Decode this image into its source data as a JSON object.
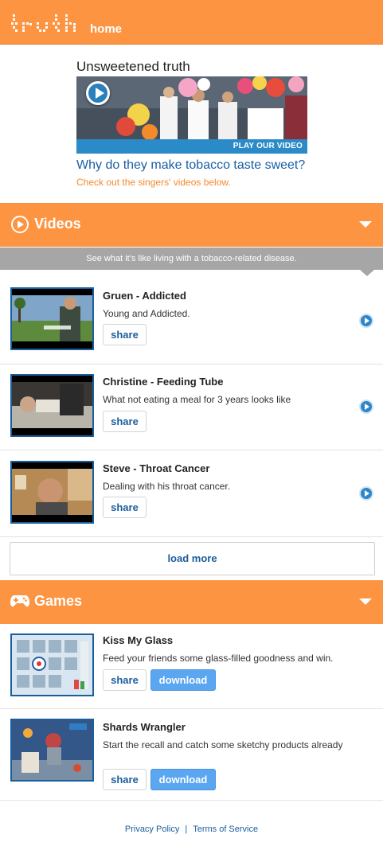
{
  "header": {
    "logo_text": "truth",
    "home_label": "home",
    "bg_color": "#fd9441"
  },
  "hero": {
    "title": "Unsweetened truth",
    "video_badge": "PLAY OUR VIDEO",
    "question": "Why do they make tobacco taste sweet?",
    "subtitle": "Check out the singers' videos below."
  },
  "videos_section": {
    "label": "Videos",
    "tagline": "See what it's like living with a tobacco-related disease.",
    "items": [
      {
        "title": "Gruen - Addicted",
        "description": "Young and Addicted.",
        "share_label": "share"
      },
      {
        "title": "Christine - Feeding Tube",
        "description": "What not eating a meal for 3 years looks like",
        "share_label": "share"
      },
      {
        "title": "Steve - Throat Cancer",
        "description": "Dealing with his throat cancer.",
        "share_label": "share"
      }
    ],
    "load_more_label": "load more"
  },
  "games_section": {
    "label": "Games",
    "items": [
      {
        "title": "Kiss My Glass",
        "description": "Feed your friends some glass-filled goodness and win.",
        "share_label": "share",
        "download_label": "download"
      },
      {
        "title": "Shards Wrangler",
        "description": "Start the recall and catch some sketchy products already",
        "share_label": "share",
        "download_label": "download"
      }
    ]
  },
  "footer": {
    "privacy_label": "Privacy Policy",
    "separator": "|",
    "terms_label": "Terms of Service"
  },
  "icons": [
    "play-circle-icon",
    "chevron-down-icon",
    "gamepad-icon",
    "play-icon"
  ]
}
